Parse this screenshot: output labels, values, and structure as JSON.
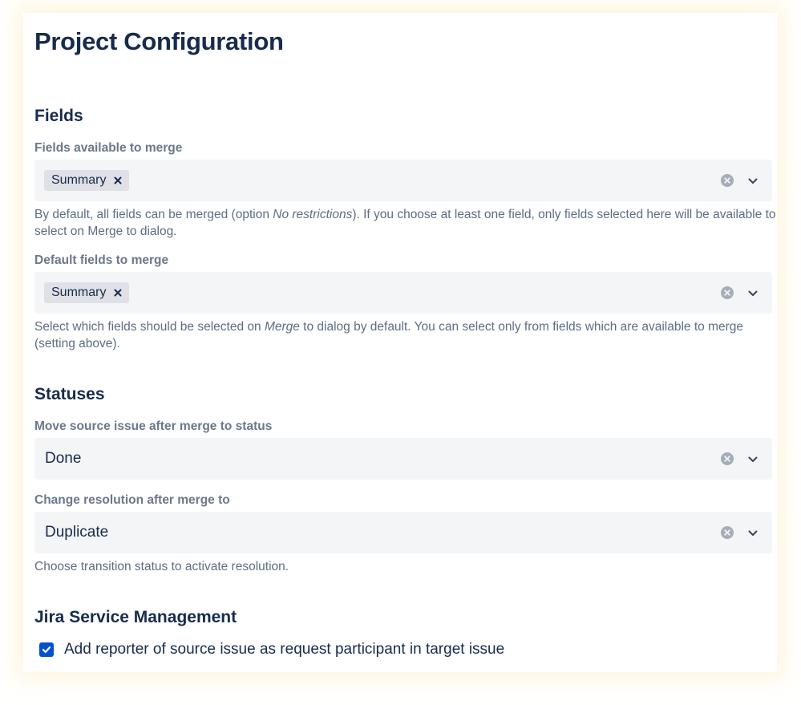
{
  "page": {
    "title": "Project Configuration"
  },
  "fields_section": {
    "heading": "Fields",
    "available": {
      "label": "Fields available to merge",
      "tags": [
        "Summary"
      ],
      "help_parts": [
        "By default, all fields can be merged (option ",
        "No restrictions",
        "). If you choose at least one field, only fields selected here will be available to select on Merge to dialog."
      ]
    },
    "defaults": {
      "label": "Default fields to merge",
      "tags": [
        "Summary"
      ],
      "help_parts": [
        "Select which fields should be selected on ",
        "Merge",
        " to dialog by default. You can select only from fields which are available to merge (setting above)."
      ]
    }
  },
  "statuses_section": {
    "heading": "Statuses",
    "move_status": {
      "label": "Move source issue after merge to status",
      "value": "Done"
    },
    "resolution": {
      "label": "Change resolution after merge to",
      "value": "Duplicate",
      "help": "Choose transition status to activate resolution."
    }
  },
  "jsm_section": {
    "heading": "Jira Service Management",
    "add_reporter": {
      "label": "Add reporter of source issue as request participant in target issue",
      "checked": true
    }
  },
  "colors": {
    "text": "#172B4D",
    "label": "#6B778C",
    "help": "#5E6C84",
    "field_bg": "#F4F5F7",
    "tag_bg": "#DFE1E6",
    "checkbox": "#0052CC",
    "icon": "#A5ADBA"
  },
  "icons": [
    "tag-remove-icon",
    "clear-icon",
    "chevron-down-icon",
    "checkmark-icon"
  ]
}
